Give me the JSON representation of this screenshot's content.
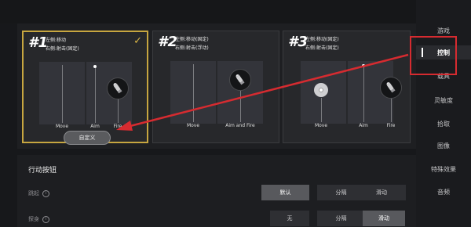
{
  "layouts": [
    {
      "num": "#1",
      "desc": "左侧:移动\n右侧:射击(固定)",
      "labels": [
        "Move",
        "Aim",
        "Fire"
      ],
      "selected": true
    },
    {
      "num": "#2",
      "desc": "左侧:移动(固定)\n右侧:射击(浮动)",
      "labels": [
        "Move",
        "Aim and Fire"
      ]
    },
    {
      "num": "#3",
      "desc": "左侧:移动(固定)\n右侧:射击(固定)",
      "labels": [
        "Move",
        "Aim",
        "Fire"
      ]
    }
  ],
  "customize_label": "自定义",
  "action_buttons": {
    "title": "行动按钮",
    "rows": [
      {
        "label": "跳起",
        "info": "i",
        "options": [
          "默认",
          "分隔",
          "滑动"
        ],
        "selected": 0
      },
      {
        "label": "探身",
        "info": "i",
        "options": [
          "无",
          "分隔",
          "滑动"
        ],
        "selected": 2
      }
    ]
  },
  "sidebar": {
    "items": [
      "游戏",
      "控制",
      "载具",
      "灵敏度",
      "拾取",
      "图像",
      "特殊效果",
      "音频"
    ],
    "active": 1
  },
  "colors": {
    "selected_border": "#c7a640",
    "highlight_red": "#d62b30"
  }
}
